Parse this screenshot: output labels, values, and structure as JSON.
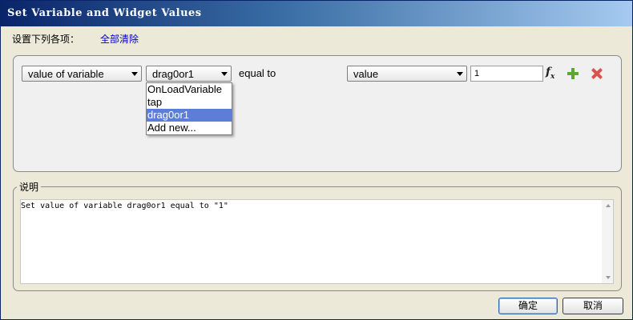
{
  "window": {
    "title": "Set Variable and Widget Values"
  },
  "header": {
    "prompt": "设置下列各项：",
    "clear_all": "全部清除"
  },
  "condition": {
    "target_select": "value of variable",
    "variable_select": "drag0or1",
    "operator_text": "equal to",
    "value_type_select": "value",
    "value_input": "1",
    "fx_label": "f",
    "fx_sub": "x"
  },
  "dropdown": {
    "options": [
      "OnLoadVariable",
      "tap",
      "drag0or1",
      "Add new..."
    ],
    "selected_index": 2
  },
  "description": {
    "label": "说明",
    "text": "Set value of variable drag0or1 equal to \"1\""
  },
  "buttons": {
    "ok": "确定",
    "cancel": "取消"
  },
  "colors": {
    "title_bar": "#0a246a",
    "selection": "#5c7ed8",
    "link": "#0000cc",
    "add": "#5aa82f",
    "delete": "#d9534f"
  },
  "icons": [
    "fx-icon",
    "plus-icon",
    "close-icon"
  ]
}
